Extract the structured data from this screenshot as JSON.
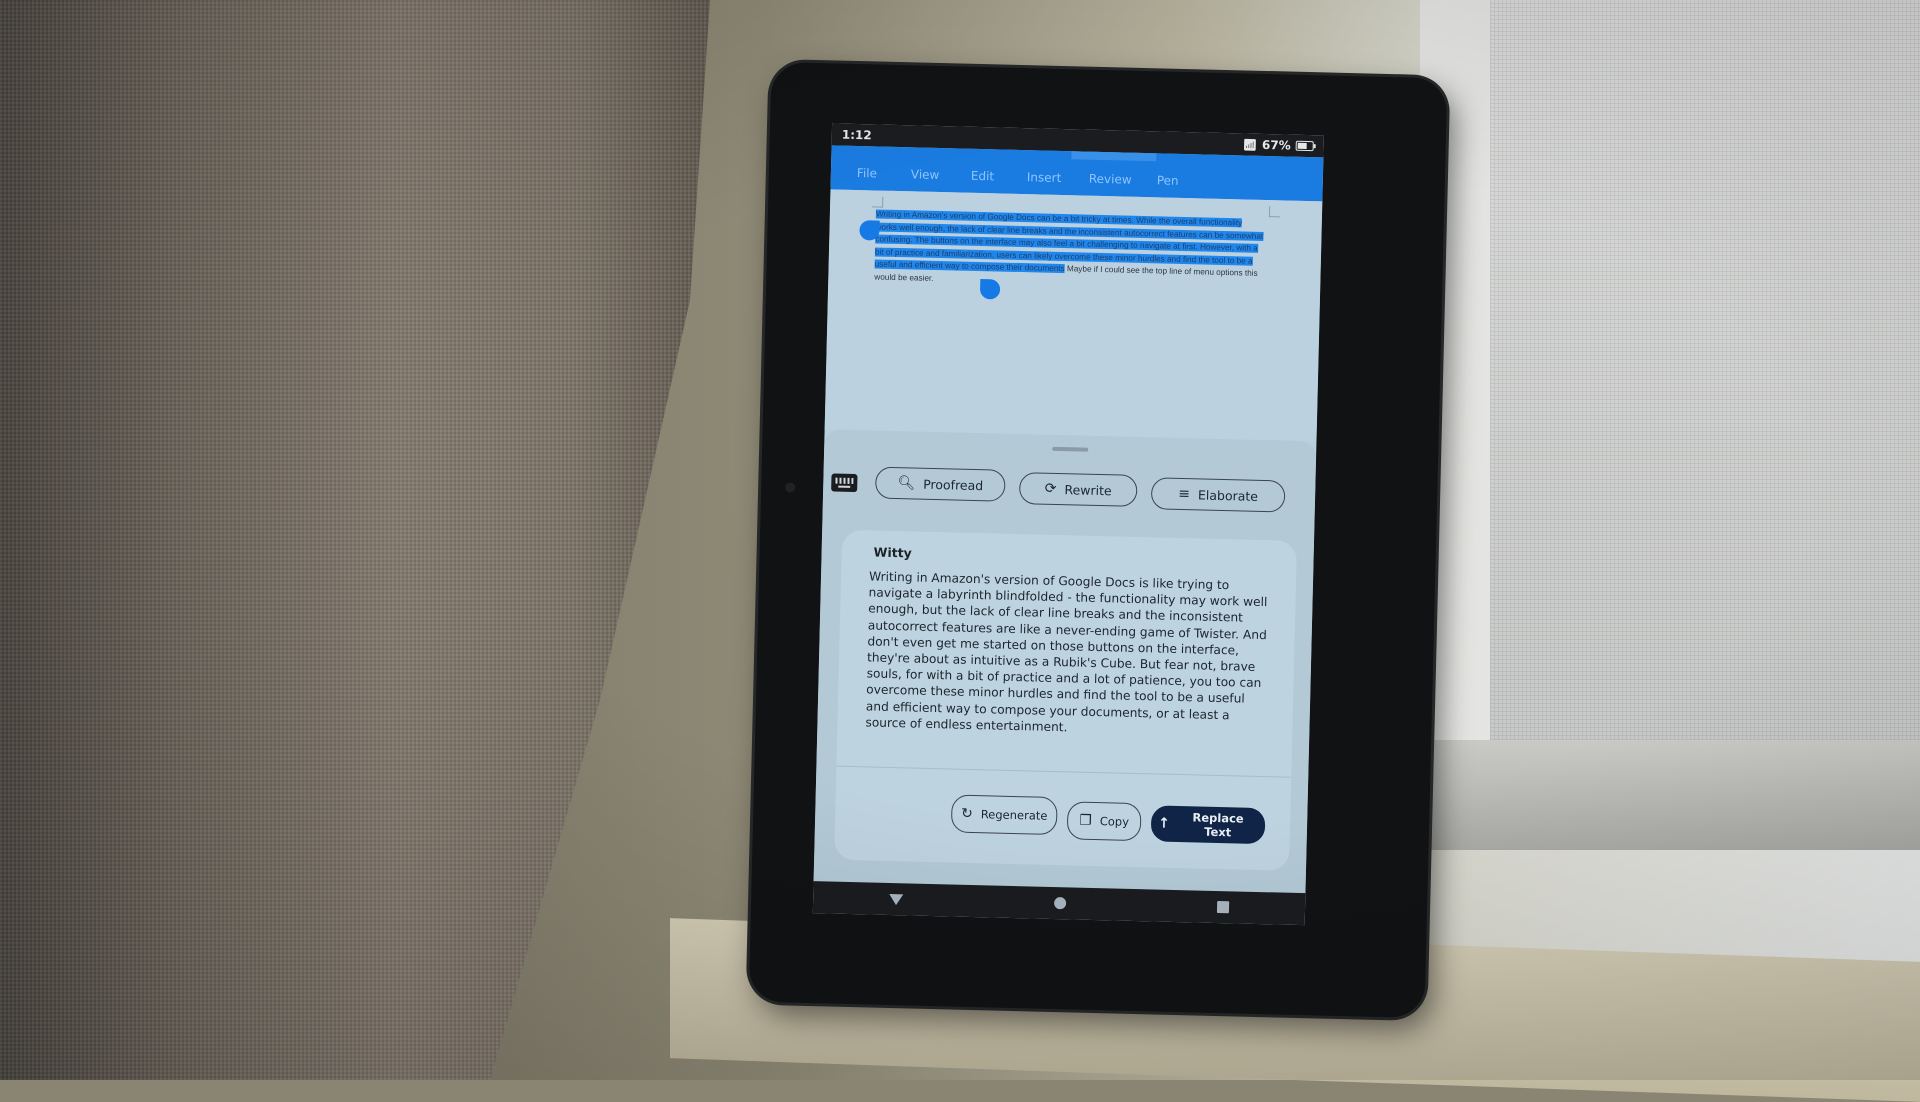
{
  "status_bar": {
    "time": "1:12",
    "battery": "67%",
    "wifi_icon": "wifi-icon",
    "battery_icon": "battery-icon"
  },
  "app_menu": {
    "items": [
      "File",
      "View",
      "Edit",
      "Insert",
      "Review",
      "Pen"
    ]
  },
  "document": {
    "selected_text": "Writing in Amazon's version of Google Docs can be a bit tricky at times. While the overall functionality works well enough, the lack of clear line breaks and the inconsistent autocorrect features can be somewhat confusing. The buttons on the interface may also feel a bit challenging to navigate at first. However, with a bit of practice and familiarization, users can likely overcome these minor hurdles and find the tool to be a useful and efficient way to compose their documents",
    "unselected_text": " Maybe if I could see the top line of menu options this would be easier."
  },
  "ai_panel": {
    "keyboard_icon": "keyboard-icon",
    "actions": [
      {
        "label": "Proofread",
        "icon": "proofread-icon"
      },
      {
        "label": "Rewrite",
        "icon": "rewrite-icon"
      },
      {
        "label": "Elaborate",
        "icon": "elaborate-icon"
      }
    ],
    "result": {
      "style": "Witty",
      "text": "Writing in Amazon's version of Google Docs is like trying to navigate a labyrinth blindfolded - the functionality may work well enough, but the lack of clear line breaks and the inconsistent autocorrect features are like a never-ending game of Twister. And don't even get me started on those buttons on the interface, they're about as intuitive as a Rubik's Cube. But fear not, brave souls, for with a bit of practice and a lot of patience, you too can overcome these minor hurdles and find the tool to be a useful and efficient way to compose your documents, or at least a source of endless entertainment."
    },
    "buttons": {
      "regenerate": "Regenerate",
      "copy": "Copy",
      "replace": "Replace Text"
    }
  },
  "nav_bar": {
    "back": "back-icon",
    "home": "home-icon",
    "recents": "recents-icon"
  },
  "colors": {
    "header_blue": "#1a7be0",
    "selection_blue": "#1f86ee",
    "replace_button": "#0f2447"
  }
}
